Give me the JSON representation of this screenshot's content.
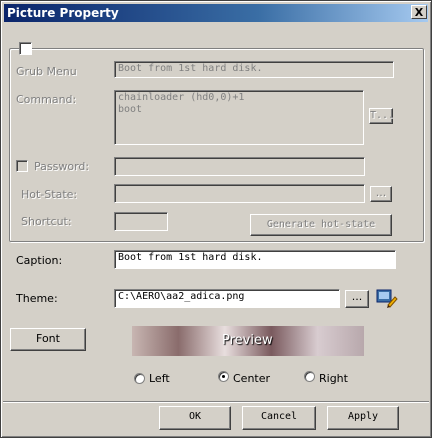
{
  "window": {
    "title": "Picture Property",
    "close_label": "X"
  },
  "group": {
    "enabled_checked": false
  },
  "grub_menu": {
    "label": "Grub Menu",
    "value": "Boot from 1st hard disk."
  },
  "command": {
    "label": "Command:",
    "value": "chainloader (hd0,0)+1\nboot",
    "button_label": "T..."
  },
  "password": {
    "label": "Password:",
    "checked": false,
    "value": ""
  },
  "hot_state": {
    "label": "Hot-State:",
    "value": "",
    "browse_label": "..."
  },
  "shortcut": {
    "label": "Shortcut:",
    "value": "",
    "generate_label": "Generate hot-state"
  },
  "caption": {
    "label": "Caption:",
    "value": "Boot from 1st hard disk."
  },
  "theme": {
    "label": "Theme:",
    "value": "C:\\AERO\\aa2_adica.png",
    "browse_label": "...",
    "icon": "edit-theme-icon"
  },
  "font_button_label": "Font",
  "preview": {
    "text": "Preview"
  },
  "alignment": {
    "options": [
      "Left",
      "Center",
      "Right"
    ],
    "selected": "Center"
  },
  "buttons": {
    "ok": "OK",
    "cancel": "Cancel",
    "apply": "Apply"
  }
}
